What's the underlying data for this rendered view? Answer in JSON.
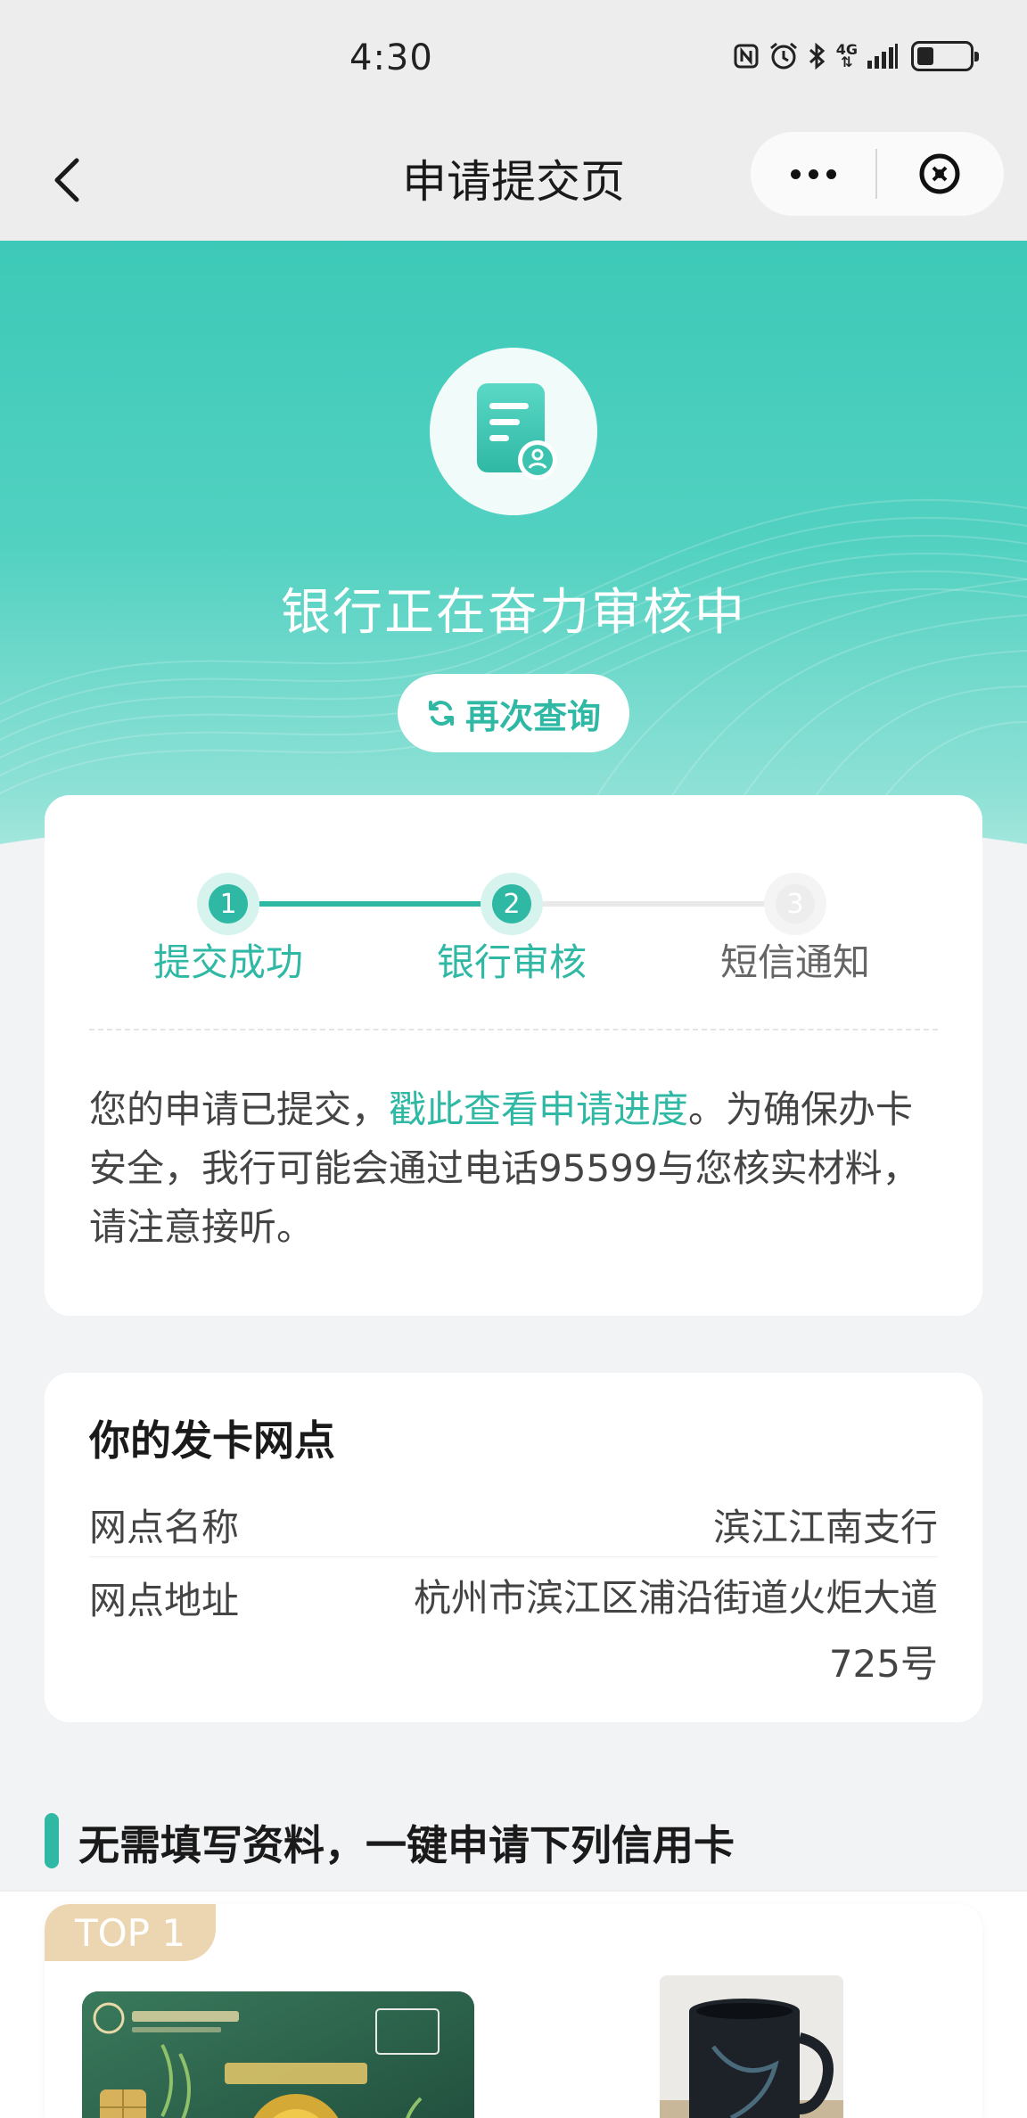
{
  "status_bar": {
    "time": "4:30",
    "network": "4G"
  },
  "nav": {
    "title": "申请提交页"
  },
  "hero": {
    "title": "银行正在奋力审核中",
    "requery_label": "再次查询"
  },
  "progress": {
    "steps": [
      {
        "number": "1",
        "label": "提交成功",
        "state": "done"
      },
      {
        "number": "2",
        "label": "银行审核",
        "state": "current"
      },
      {
        "number": "3",
        "label": "短信通知",
        "state": "pending"
      }
    ],
    "message_prefix": "您的申请已提交，",
    "message_link": "戳此查看申请进度",
    "message_suffix": "。为确保办卡安全，我行可能会通过电话95599与您核实材料，请注意接听。"
  },
  "branch": {
    "title": "你的发卡网点",
    "name_label": "网点名称",
    "name_value": "滨江江南支行",
    "address_label": "网点地址",
    "address_value": "杭州市滨江区浦沿街道火炬大道725号"
  },
  "recommend": {
    "title": "无需填写资料，一键申请下列信用卡",
    "badge": "TOP 1"
  },
  "colors": {
    "accent": "#2fb8a4",
    "hero": "#3dc9b7",
    "badge": "#ecd6b2"
  }
}
